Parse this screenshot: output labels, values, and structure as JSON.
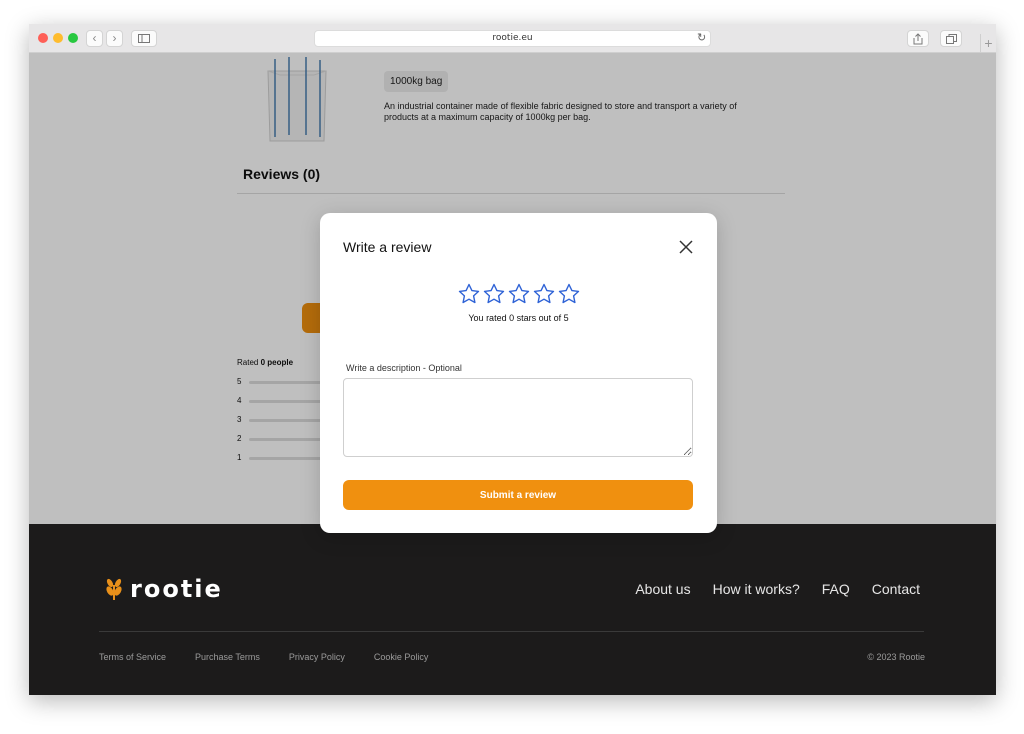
{
  "browser": {
    "url": "rootie.eu",
    "traffic_colors": {
      "close": "#fe5f57",
      "minimize": "#febc2e",
      "zoom": "#28c840"
    },
    "reload_icon": "reload-icon",
    "new_tab_icon": "plus-icon"
  },
  "product": {
    "tag": "1000kg bag",
    "description": "An industrial container made of flexible fabric designed to store and transport a variety of products at a maximum capacity of 1000kg per bag."
  },
  "reviews": {
    "title": "Reviews (0)",
    "rated_prefix": "Rated",
    "rated_count": "0 people",
    "rows": [
      "5",
      "4",
      "3",
      "2",
      "1"
    ]
  },
  "modal": {
    "title": "Write a review",
    "rating": 0,
    "max_rating": 5,
    "rated_text": "You rated 0 stars out of 5",
    "description_label": "Write a description - Optional",
    "description_value": "",
    "submit_label": "Submit a review",
    "accent": "#f0900f",
    "star_color": "#2e62d6"
  },
  "footer": {
    "logo_text": "rootie",
    "nav": [
      "About us",
      "How it works?",
      "FAQ",
      "Contact"
    ],
    "links": [
      "Terms of Service",
      "Purchase Terms",
      "Privacy Policy",
      "Cookie Policy"
    ],
    "copyright": "© 2023 Rootie"
  }
}
